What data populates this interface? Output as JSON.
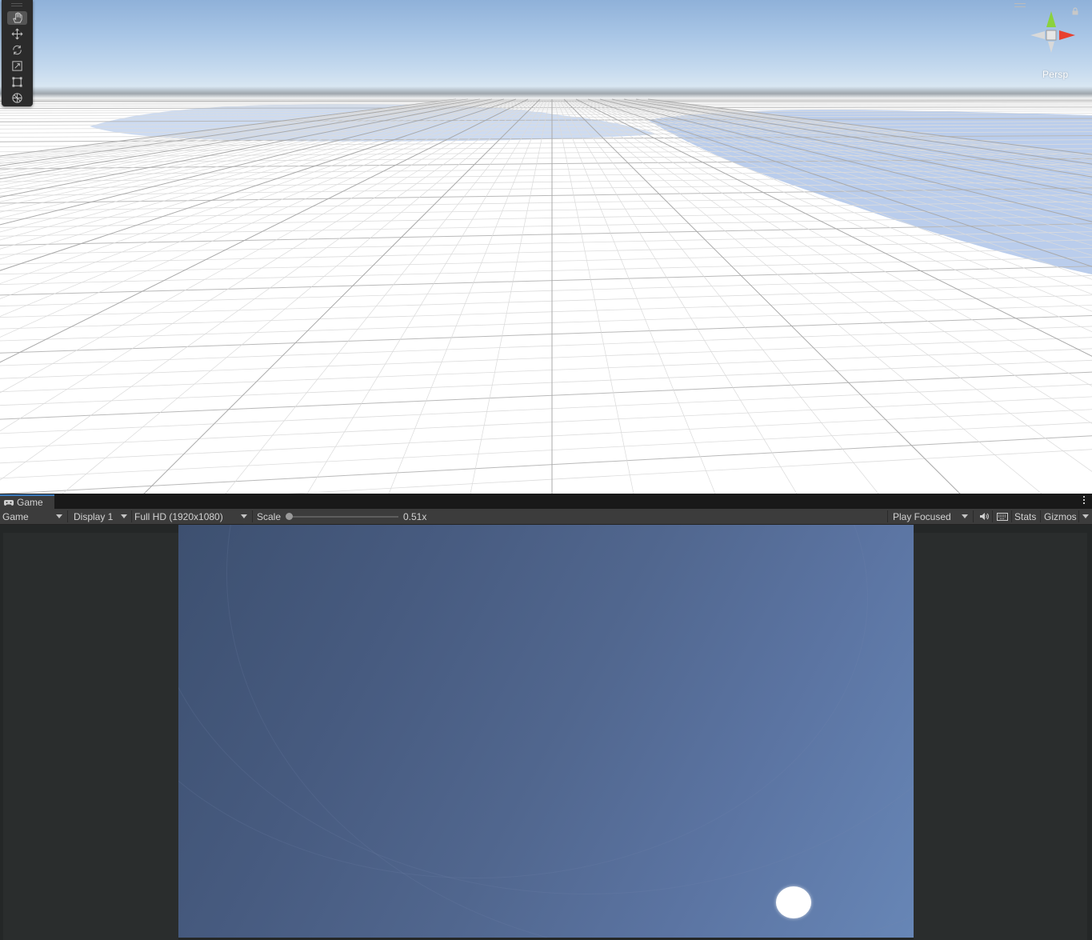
{
  "scene_view": {
    "camera_mode_label": "Persp",
    "tools": [
      {
        "name": "hand-tool",
        "icon": "hand-icon",
        "active": true
      },
      {
        "name": "move-tool",
        "icon": "move-arrows-icon",
        "active": false
      },
      {
        "name": "rotate-tool",
        "icon": "rotate-icon",
        "active": false
      },
      {
        "name": "scale-tool",
        "icon": "scale-icon",
        "active": false
      },
      {
        "name": "rect-tool",
        "icon": "rect-transform-icon",
        "active": false
      },
      {
        "name": "transform-tool",
        "icon": "transform-icon",
        "active": false
      }
    ],
    "gizmo_axes": {
      "y_color": "#8bd23d",
      "x_color": "#e8402f",
      "z_color": "#3b73d6"
    }
  },
  "game_view": {
    "tab_label": "Game",
    "toolbar": {
      "view_mode": "Game",
      "display": "Display 1",
      "resolution": "Full HD (1920x1080)",
      "scale_label": "Scale",
      "scale_value": "0.51x",
      "play_mode": "Play Focused",
      "stats_label": "Stats",
      "gizmos_label": "Gizmos"
    }
  }
}
